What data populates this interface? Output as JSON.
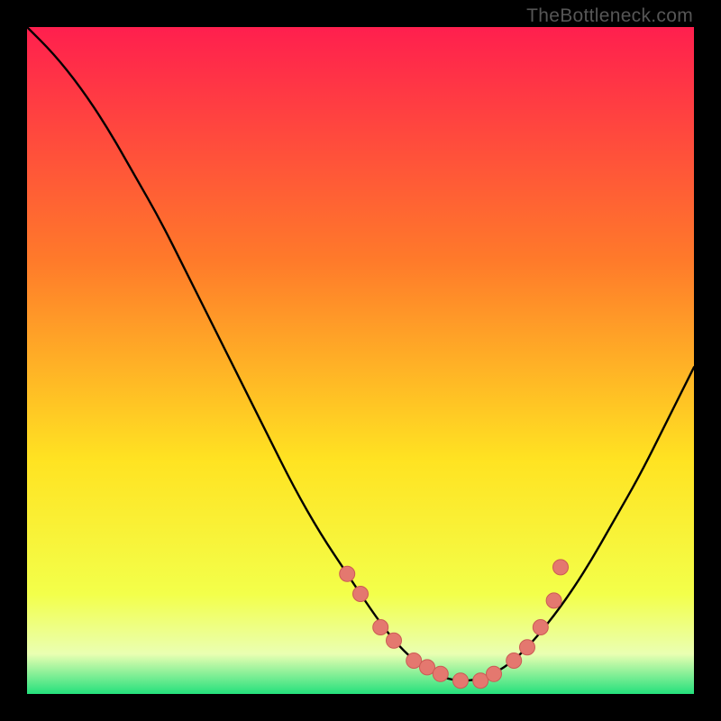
{
  "watermark": "TheBottleneck.com",
  "colors": {
    "gradient_top": "#ff1f4e",
    "gradient_mid_upper": "#ff7a2a",
    "gradient_mid": "#ffe322",
    "gradient_lower": "#f3ff4a",
    "gradient_pale": "#eaffb2",
    "gradient_bottom": "#24e07c",
    "curve": "#000000",
    "dot_fill": "#e4786f",
    "dot_stroke": "#cc5a54"
  },
  "chart_data": {
    "type": "line",
    "title": "",
    "xlabel": "",
    "ylabel": "",
    "xlim": [
      0,
      100
    ],
    "ylim": [
      0,
      100
    ],
    "series": [
      {
        "name": "bottleneck-curve",
        "x": [
          0,
          4,
          8,
          12,
          16,
          20,
          24,
          28,
          32,
          36,
          40,
          44,
          48,
          52,
          55,
          58,
          61,
          64,
          67,
          70,
          73,
          76,
          80,
          84,
          88,
          92,
          96,
          100
        ],
        "y": [
          100,
          96,
          91,
          85,
          78,
          71,
          63,
          55,
          47,
          39,
          31,
          24,
          18,
          12,
          8,
          5,
          3,
          2,
          2,
          3,
          5,
          8,
          13,
          19,
          26,
          33,
          41,
          49
        ]
      }
    ],
    "dots": {
      "name": "sample-points",
      "x": [
        48,
        50,
        53,
        55,
        58,
        60,
        62,
        65,
        68,
        70,
        73,
        75,
        77,
        79,
        80
      ],
      "y": [
        18,
        15,
        10,
        8,
        5,
        4,
        3,
        2,
        2,
        3,
        5,
        7,
        10,
        14,
        19
      ]
    }
  }
}
